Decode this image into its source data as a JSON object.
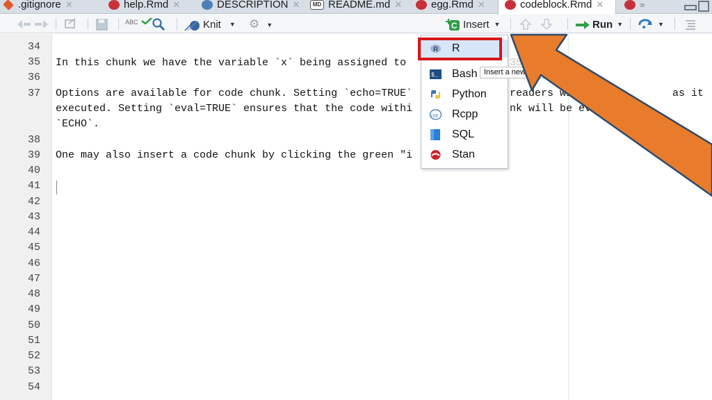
{
  "tabs": [
    {
      "label": ".gitignore",
      "icon": "git-icon",
      "active": false
    },
    {
      "label": "help.Rmd",
      "icon": "rmd-file-icon",
      "active": false
    },
    {
      "label": "DESCRIPTION",
      "icon": "description-file-icon",
      "active": false
    },
    {
      "label": "README.md",
      "icon": "markdown-file-icon",
      "icon_text": "MD",
      "active": false
    },
    {
      "label": "egg.Rmd",
      "icon": "rmd-file-icon",
      "active": false
    },
    {
      "label": "codeblock.Rmd",
      "icon": "rmd-file-icon",
      "active": true
    }
  ],
  "tab_overflow": "»",
  "toolbar": {
    "knit_label": "Knit",
    "insert_label": "Insert",
    "run_label": "Run",
    "spell_label": "ABC"
  },
  "editor": {
    "lines": [
      {
        "num": "34",
        "text": ""
      },
      {
        "num": "35",
        "text": "In this chunk we have the variable `x` being assigned to"
      },
      {
        "num": "36",
        "text": ""
      },
      {
        "num": "37",
        "text": "Options are available for code chunk. Setting `echo=TRUE`"
      },
      {
        "num": "",
        "text": "executed. Setting `eval=TRUE` ensures that the code withi"
      },
      {
        "num": "",
        "text": "`ECHO`."
      },
      {
        "num": "38",
        "text": ""
      },
      {
        "num": "39",
        "text": "One may also insert a code chunk by clicking the green \"i"
      },
      {
        "num": "40",
        "text": ""
      },
      {
        "num": "41",
        "text": ""
      },
      {
        "num": "42",
        "text": ""
      },
      {
        "num": "43",
        "text": ""
      },
      {
        "num": "44",
        "text": ""
      },
      {
        "num": "45",
        "text": ""
      },
      {
        "num": "46",
        "text": ""
      },
      {
        "num": "47",
        "text": ""
      },
      {
        "num": "48",
        "text": ""
      },
      {
        "num": "49",
        "text": ""
      },
      {
        "num": "50",
        "text": ""
      },
      {
        "num": "51",
        "text": ""
      },
      {
        "num": "52",
        "text": ""
      },
      {
        "num": "53",
        "text": ""
      },
      {
        "num": "54",
        "text": ""
      }
    ],
    "right_fragments": {
      "line35": "356",
      "line37": "readers will see          as it",
      "line37b": "nk will be evaluated",
      "tooltip": "Insert a new R chunk"
    }
  },
  "insert_menu": {
    "items": [
      {
        "label": "R",
        "icon": "r-icon",
        "highlighted": true
      },
      {
        "label": "Bash",
        "icon": "bash-terminal-icon"
      },
      {
        "label": "Python",
        "icon": "python-icon"
      },
      {
        "label": "Rcpp",
        "icon": "cpp-icon",
        "icon_text": "cpp"
      },
      {
        "label": "SQL",
        "icon": "sql-database-icon"
      },
      {
        "label": "Stan",
        "icon": "stan-icon"
      }
    ]
  },
  "colors": {
    "highlight_box": "#d8161b",
    "arrow": "#e87c2a",
    "arrow_outline": "#2e4a6b"
  }
}
